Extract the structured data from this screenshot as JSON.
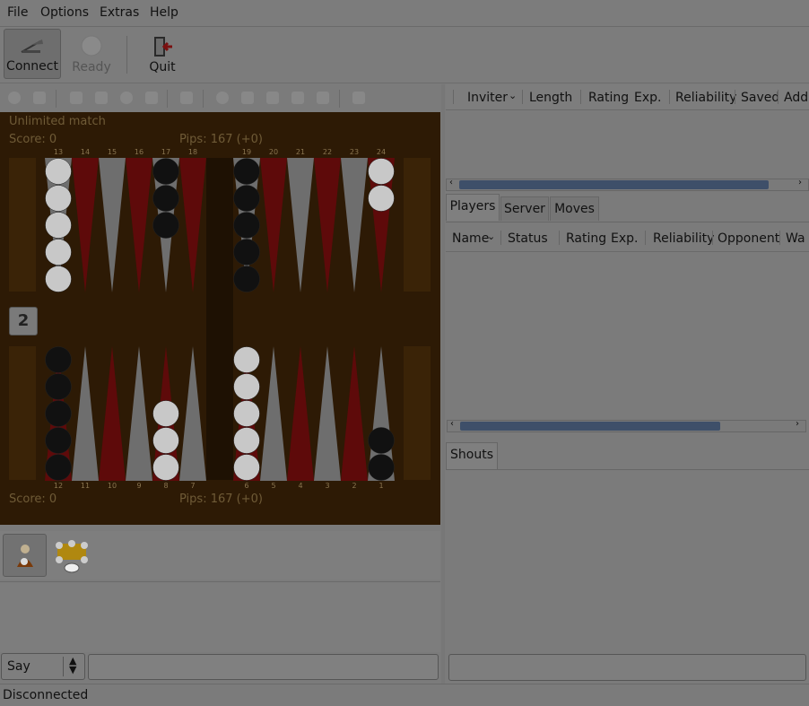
{
  "menubar": {
    "items": [
      "File",
      "Options",
      "Extras",
      "Help"
    ]
  },
  "toolbar": {
    "connect": {
      "label": "Connect",
      "icon": "connect-icon"
    },
    "ready": {
      "label": "Ready",
      "icon": "ready-icon"
    },
    "quit": {
      "label": "Quit",
      "icon": "quit-icon"
    }
  },
  "board": {
    "match_title": "Unlimited match",
    "top_score": "Score: 0",
    "top_pips": "Pips: 167 (+0)",
    "bottom_score": "Score: 0",
    "bottom_pips": "Pips: 167 (+0)",
    "cube_value": "2",
    "top_points": [
      "13",
      "14",
      "15",
      "16",
      "17",
      "18",
      "19",
      "20",
      "21",
      "22",
      "23",
      "24"
    ],
    "bottom_points": [
      "12",
      "11",
      "10",
      "9",
      "8",
      "7",
      "6",
      "5",
      "4",
      "3",
      "2",
      "1"
    ]
  },
  "chat": {
    "say_label": "Say",
    "input_value": ""
  },
  "invitations_table": {
    "columns": [
      "Inviter",
      "Length",
      "Rating",
      "Exp.",
      "Reliability",
      "Saved",
      "Add"
    ]
  },
  "tabs": {
    "players": "Players",
    "server": "Server",
    "moves": "Moves"
  },
  "players_table": {
    "columns": [
      "Name",
      "Status",
      "Rating",
      "Exp.",
      "Reliability",
      "Opponent",
      "Wa"
    ]
  },
  "shouts": {
    "tab_label": "Shouts"
  },
  "status": {
    "text": "Disconnected"
  },
  "colors": {
    "board_bg": "#2d1a05",
    "frame": "#3d2407",
    "red_point": "#5e0a0a",
    "grey_point": "#6e6e6e",
    "white_checker": "#c8c8c8",
    "black_checker": "#111111",
    "scroll_thumb": "#3e4f69"
  }
}
